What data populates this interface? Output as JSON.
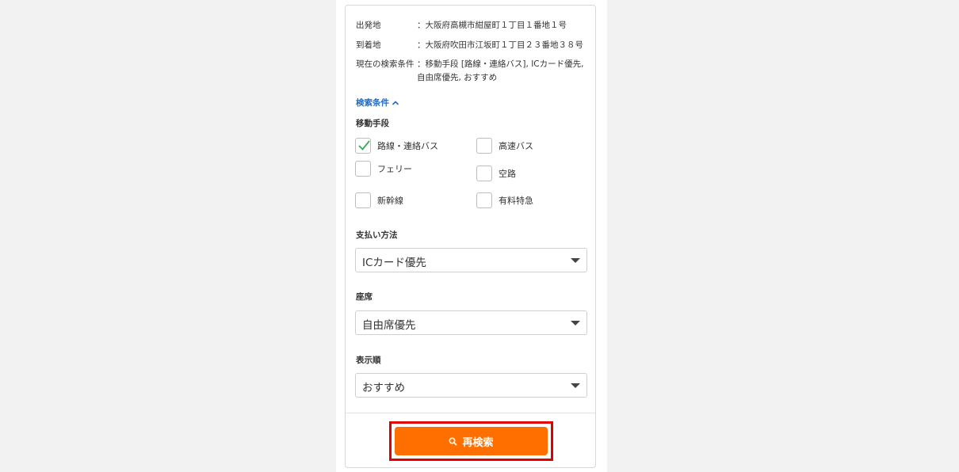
{
  "info": {
    "origin": {
      "label": "出発地",
      "value": [
        "：大阪府高槻市紺屋町１丁目１番地１号"
      ]
    },
    "destination": {
      "label": "到着地",
      "value": [
        "：大阪府吹田市江坂町１丁目２３番地３８号"
      ]
    },
    "conditions": {
      "label": "現在の検索条件",
      "value": [
        "：移動手段 [路線・連絡バス], ICカード優先,",
        "自由席優先, おすすめ"
      ]
    }
  },
  "toggle": {
    "label": "検索条件",
    "icon": "chevron-up-icon",
    "color": "#1e6bc9"
  },
  "transport": {
    "title": "移動手段",
    "options": [
      {
        "label": "路線・連絡バス",
        "checked": true
      },
      {
        "label": "高速バス",
        "checked": false
      },
      {
        "label": "フェリー",
        "checked": false
      },
      {
        "label": "空路",
        "checked": false
      },
      {
        "label": "新幹線",
        "checked": false
      },
      {
        "label": "有料特急",
        "checked": false
      }
    ]
  },
  "payment": {
    "title": "支払い方法",
    "selected": "ICカード優先"
  },
  "seat": {
    "title": "座席",
    "selected": "自由席優先"
  },
  "order": {
    "title": "表示順",
    "selected": "おすすめ"
  },
  "search_button": {
    "label": "再検索",
    "icon": "search-icon",
    "color": "#ff6f00"
  },
  "colors": {
    "check": "#3aaa5a",
    "highlight": "#e00000"
  }
}
